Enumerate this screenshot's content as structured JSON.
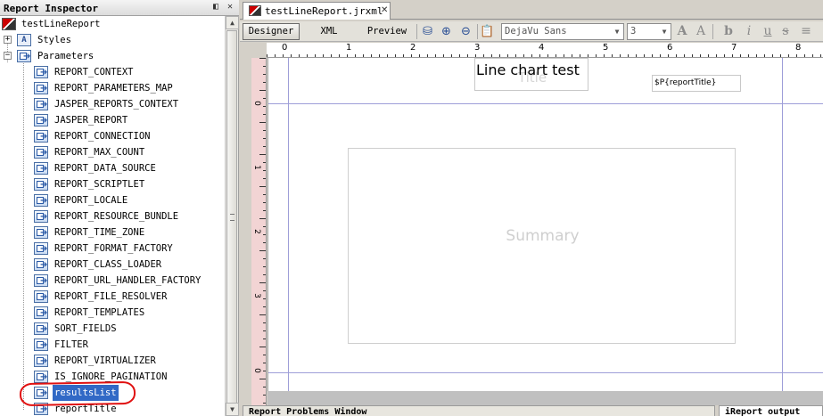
{
  "inspector": {
    "title": "Report Inspector",
    "root": "testLineReport",
    "styles": "Styles",
    "parameters": "Parameters",
    "params": [
      "REPORT_CONTEXT",
      "REPORT_PARAMETERS_MAP",
      "JASPER_REPORTS_CONTEXT",
      "JASPER_REPORT",
      "REPORT_CONNECTION",
      "REPORT_MAX_COUNT",
      "REPORT_DATA_SOURCE",
      "REPORT_SCRIPTLET",
      "REPORT_LOCALE",
      "REPORT_RESOURCE_BUNDLE",
      "REPORT_TIME_ZONE",
      "REPORT_FORMAT_FACTORY",
      "REPORT_CLASS_LOADER",
      "REPORT_URL_HANDLER_FACTORY",
      "REPORT_FILE_RESOLVER",
      "REPORT_TEMPLATES",
      "SORT_FIELDS",
      "FILTER",
      "REPORT_VIRTUALIZER",
      "IS_IGNORE_PAGINATION",
      "resultsList",
      "reportTitle"
    ],
    "selected_param": "resultsList",
    "highlight_color": "#3169c6",
    "annotation_color": "#e01010"
  },
  "editor": {
    "tab_label": "testLineReport.jrxml",
    "views": {
      "designer": "Designer",
      "xml": "XML",
      "preview": "Preview"
    },
    "active_view": "Designer",
    "font_name": "DejaVu Sans",
    "font_size": "3",
    "ruler_top": [
      "0",
      "1",
      "2",
      "3",
      "4",
      "5",
      "6",
      "7",
      "8"
    ],
    "ruler_left": [
      "0",
      "1",
      "2",
      "3",
      "0"
    ],
    "canvas": {
      "title_watermark": "Title",
      "chart_title": "Line chart test",
      "report_title_expr": "$P{reportTitle}",
      "summary_watermark": "Summary"
    }
  },
  "bottom": {
    "problems_tab": "Report Problems Window",
    "output_tab": "iReport output"
  }
}
